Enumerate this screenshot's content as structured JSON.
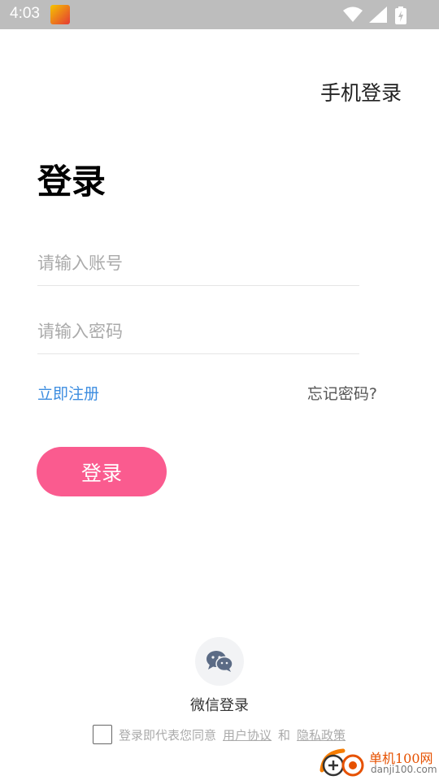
{
  "status": {
    "time": "4:03"
  },
  "header": {
    "phone_login": "手机登录"
  },
  "title": "登录",
  "form": {
    "account_placeholder": "请输入账号",
    "password_placeholder": "请输入密码",
    "register": "立即注册",
    "forgot": "忘记密码?",
    "submit": "登录"
  },
  "wechat": {
    "label": "微信登录"
  },
  "agreement": {
    "prefix": "登录即代表您同意",
    "user_agreement": "用户协议",
    "and": "和",
    "privacy_policy": "隐私政策"
  },
  "watermark": {
    "name": "单机100网",
    "url": "danji100.com"
  },
  "colors": {
    "accent_pink": "#fa5b8f",
    "link_blue": "#3d8de0",
    "statusbar": "#bdbdbd"
  }
}
